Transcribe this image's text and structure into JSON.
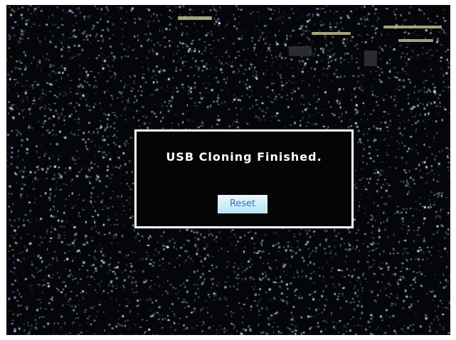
{
  "dialog": {
    "message": "USB Cloning Finished.",
    "reset_label": "Reset"
  },
  "colors": {
    "screen_background": "#050609",
    "dialog_border": "#f2f2f2",
    "message_text": "#ffffff",
    "button_background": "#cdeefa",
    "button_text": "#3a73b6"
  }
}
